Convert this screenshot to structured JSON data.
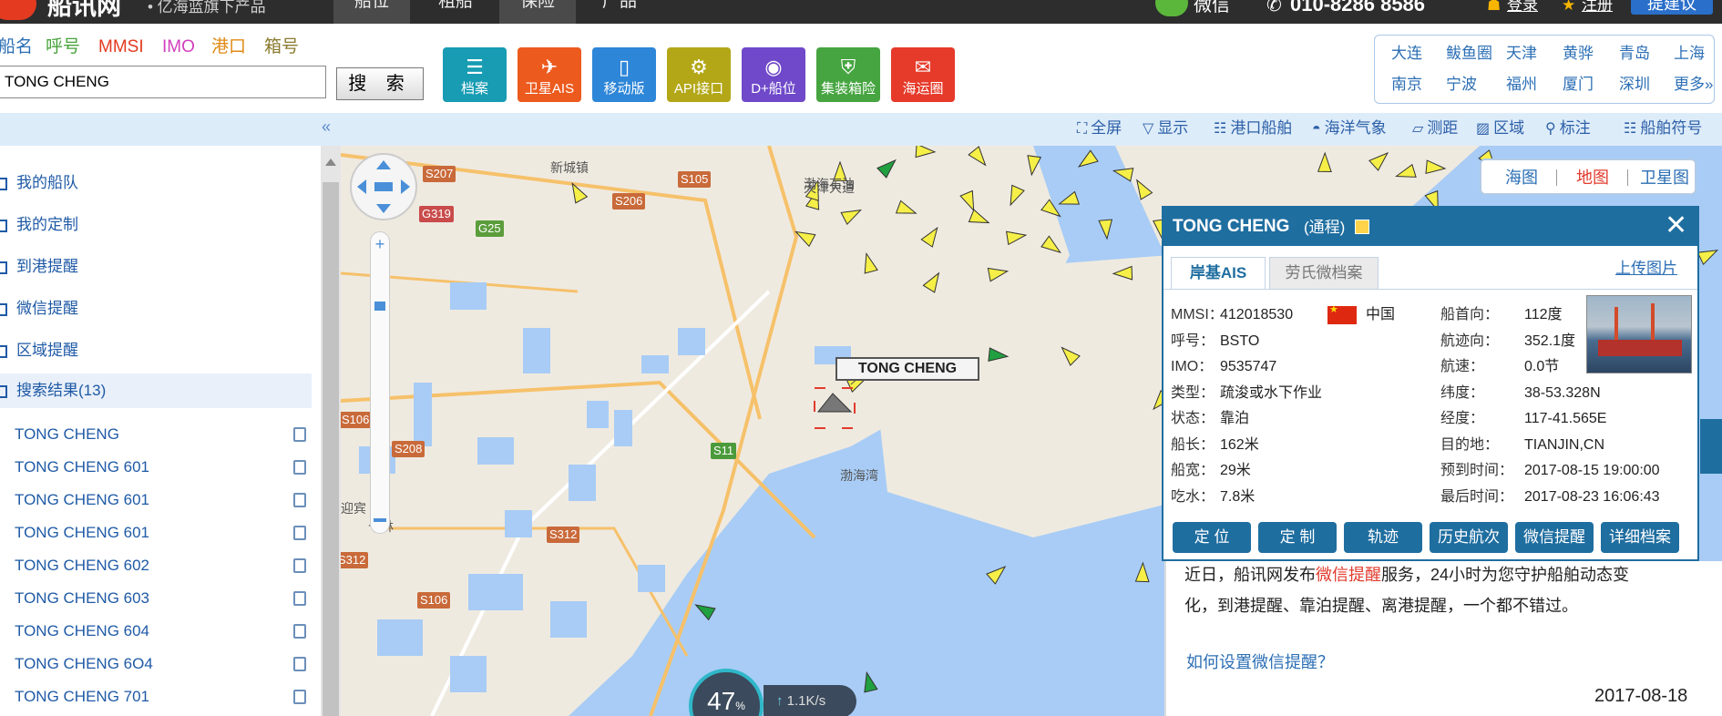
{
  "topnav": {
    "logo_text": "船讯网",
    "logo_sub": "• 亿海蓝旗下产品",
    "tabs": [
      "船位",
      "租船",
      "保险",
      "产品"
    ],
    "wechat": "微信",
    "phone": "010-8286 8586",
    "login": "登录",
    "register": "注册",
    "suggest": "提建议"
  },
  "search": {
    "types": [
      "船名",
      "呼号",
      "MMSI",
      "IMO",
      "港口",
      "箱号"
    ],
    "type_colors": [
      "#2c6fb5",
      "#47a33a",
      "#e43a20",
      "#d13fbd",
      "#e08a17",
      "#8b7b2f"
    ],
    "value": "TONG CHENG",
    "button": "搜 索"
  },
  "features": [
    {
      "label": "档案",
      "color": "#179cb3",
      "icon": "document-icon",
      "glyph": "☰"
    },
    {
      "label": "卫星AIS",
      "color": "#ec5a1e",
      "icon": "satellite-icon",
      "glyph": "✈"
    },
    {
      "label": "移动版",
      "color": "#2e86d8",
      "icon": "mobile-icon",
      "glyph": "▯"
    },
    {
      "label": "API接口",
      "color": "#b3a718",
      "icon": "gear-icon",
      "glyph": "⚙"
    },
    {
      "label": "D+船位",
      "color": "#6f49c9",
      "icon": "signal-icon",
      "glyph": "◉"
    },
    {
      "label": "集装箱险",
      "color": "#46a540",
      "icon": "insurance-icon",
      "glyph": "⛨"
    },
    {
      "label": "海运圈",
      "color": "#e63a2a",
      "icon": "chat-icon",
      "glyph": "✉"
    }
  ],
  "cities": {
    "row1": [
      "大连",
      "鲅鱼圈",
      "天津",
      "黄骅",
      "青岛",
      "上海"
    ],
    "row2": [
      "南京",
      "宁波",
      "福州",
      "厦门",
      "深圳",
      "更多»"
    ]
  },
  "toolbar": [
    {
      "label": "全屏",
      "icon": "fullscreen-icon",
      "glyph": "⛶"
    },
    {
      "label": "显示",
      "icon": "filter-icon",
      "glyph": "▽"
    },
    {
      "label": "港口船舶",
      "icon": "port-list-icon",
      "glyph": "☷"
    },
    {
      "label": "海洋气象",
      "icon": "weather-icon",
      "glyph": "◓"
    },
    {
      "label": "测距",
      "icon": "ruler-icon",
      "glyph": "▱"
    },
    {
      "label": "区域",
      "icon": "area-icon",
      "glyph": "▨"
    },
    {
      "label": "标注",
      "icon": "pin-icon",
      "glyph": "⚲"
    },
    {
      "label": "船舶符号",
      "icon": "ship-symbol-icon",
      "glyph": "☷"
    }
  ],
  "sidebar": {
    "menu": [
      "我的船队",
      "我的定制",
      "到港提醒",
      "微信提醒",
      "区域提醒",
      "搜索结果(13)"
    ],
    "ships": [
      "TONG CHENG",
      "TONG CHENG 601",
      "TONG CHENG 601",
      "TONG CHENG 601",
      "TONG CHENG 602",
      "TONG CHENG 603",
      "TONG CHENG 604",
      "TONG CHENG 6O4",
      "TONG CHENG 701"
    ]
  },
  "map": {
    "types": [
      "海图",
      "地图",
      "卫星图"
    ],
    "active_type": "地图",
    "ship_label": "TONG CHENG",
    "labels": [
      "新城镇",
      "天津大道",
      "渤海石油",
      "渤海湾",
      "渤海湾",
      "迎宾",
      "十林"
    ],
    "roads": [
      "S207",
      "S105",
      "S206",
      "G319",
      "G25",
      "S106",
      "S208",
      "S11",
      "S312",
      "S312",
      "S106"
    ],
    "speed_value": "47",
    "speed_unit": "%",
    "net_speed": "1.1K/s"
  },
  "popup": {
    "name": "TONG CHENG",
    "cn_name": "(通程)",
    "tabs": [
      "岸基AIS",
      "劳氏微档案"
    ],
    "upload": "上传图片",
    "left": [
      {
        "label": "MMSI：",
        "value": "412018530"
      },
      {
        "label": "呼号：",
        "value": "BSTO"
      },
      {
        "label": "IMO：",
        "value": "9535747"
      },
      {
        "label": "类型：",
        "value": "疏浚或水下作业"
      },
      {
        "label": "状态：",
        "value": "靠泊"
      },
      {
        "label": "船长：",
        "value": "162米"
      },
      {
        "label": "船宽：",
        "value": "29米"
      },
      {
        "label": "吃水：",
        "value": "7.8米"
      }
    ],
    "country": "中国",
    "right": [
      {
        "label": "船首向：",
        "value": "112度"
      },
      {
        "label": "航迹向：",
        "value": "352.1度"
      },
      {
        "label": "航速：",
        "value": "0.0节"
      },
      {
        "label": "纬度：",
        "value": "38-53.328N"
      },
      {
        "label": "经度：",
        "value": "117-41.565E"
      },
      {
        "label": "目的地：",
        "value": "TIANJIN,CN"
      },
      {
        "label": "预到时间：",
        "value": "2017-08-15 19:00:00"
      },
      {
        "label": "最后时间：",
        "value": "2017-08-23 16:06:43"
      }
    ],
    "buttons": [
      "定 位",
      "定 制",
      "轨迹",
      "历史航次",
      "微信提醒",
      "详细档案"
    ]
  },
  "news": {
    "line1_pre": "近日，船讯网发布",
    "line1_red": "微信提醒",
    "line1_post": "服务，24小时为您守护船舶动态变",
    "line2": "化，到港提醒、靠泊提醒、离港提醒，一个都不错过。",
    "link": "如何设置微信提醒？",
    "date": "2017-08-18"
  }
}
